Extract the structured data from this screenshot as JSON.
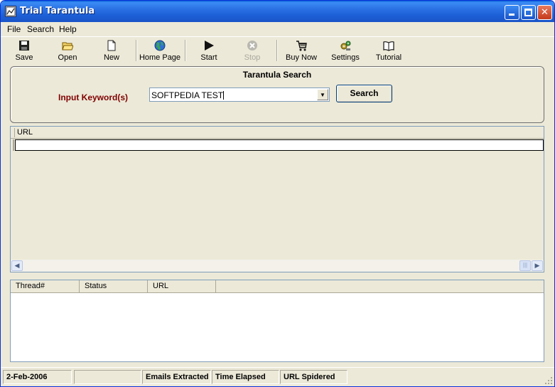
{
  "window": {
    "title": "Trial Tarantula",
    "minimize_label": "_",
    "close_label": "✕"
  },
  "menu": [
    "File",
    "Search",
    "Help"
  ],
  "toolbar": [
    {
      "label": "Save",
      "icon": "floppy-disk-icon",
      "enabled": true
    },
    {
      "label": "Open",
      "icon": "open-folder-icon",
      "enabled": true
    },
    {
      "label": "New",
      "icon": "new-document-icon",
      "enabled": true
    },
    {
      "label": "Home Page",
      "icon": "globe-icon",
      "enabled": true
    },
    {
      "label": "Start",
      "icon": "play-icon",
      "enabled": true
    },
    {
      "label": "Stop",
      "icon": "stop-icon",
      "enabled": false
    },
    {
      "label": "Buy Now",
      "icon": "shopping-cart-icon",
      "enabled": true
    },
    {
      "label": "Settings",
      "icon": "settings-icon",
      "enabled": true
    },
    {
      "label": "Tutorial",
      "icon": "book-icon",
      "enabled": true
    }
  ],
  "search": {
    "title": "Tarantula Search",
    "keyword_label": "Input Keyword(s)",
    "keyword_value": "SOFTPEDIA TEST",
    "button_label": "Search",
    "label_color": "#800000"
  },
  "url_list": {
    "columns": [
      "URL"
    ]
  },
  "thread_list": {
    "columns": [
      "Thread#",
      "Status",
      "URL"
    ]
  },
  "statusbar": {
    "date": "2-Feb-2006",
    "panel2": "",
    "emails": "Emails Extracted",
    "time": "Time Elapsed",
    "spidered": "URL Spidered"
  },
  "colors": {
    "title_bar": "#1c5fd6",
    "window_bg": "#ece9d8",
    "close_button": "#c4381a"
  }
}
